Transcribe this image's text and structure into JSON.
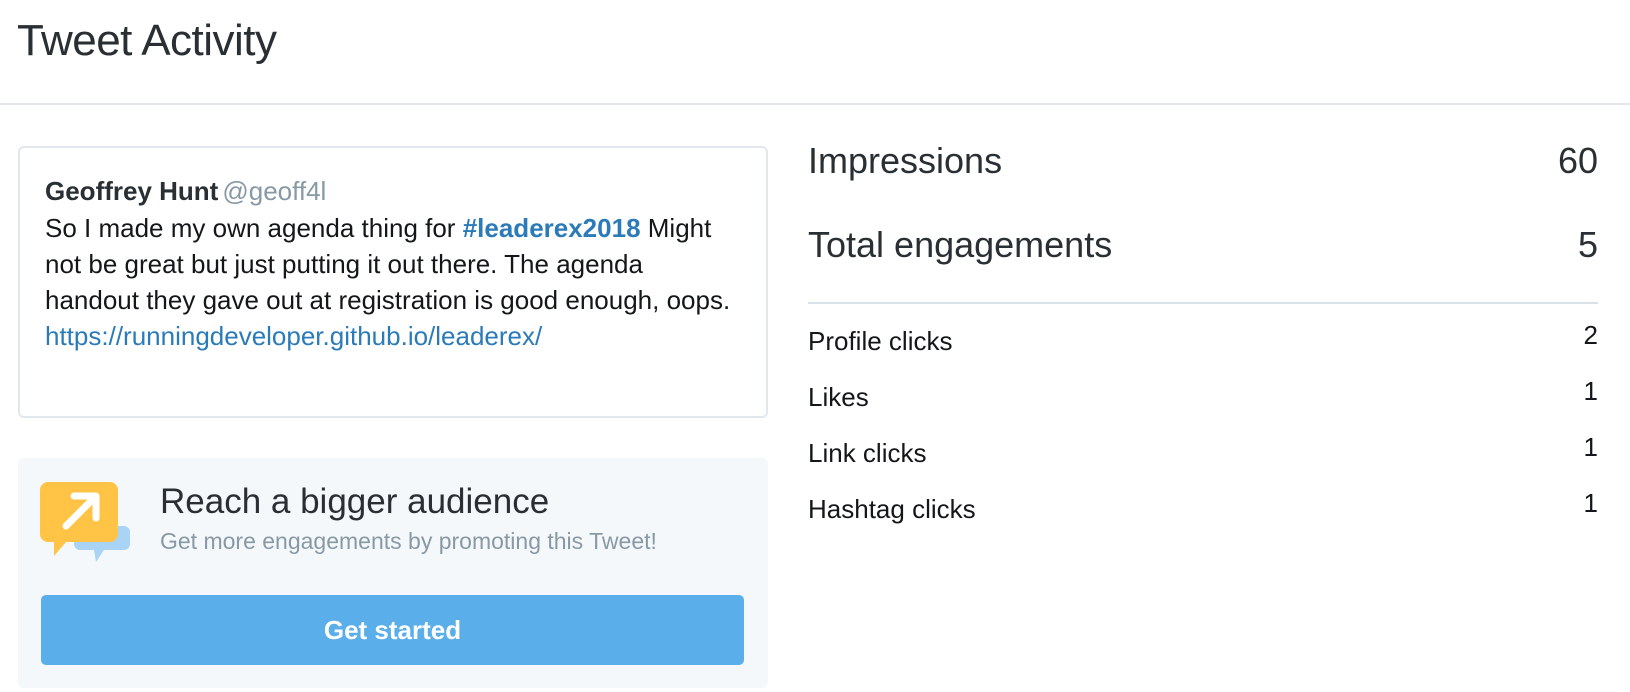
{
  "header": {
    "title": "Tweet Activity"
  },
  "tweet": {
    "name": "Geoffrey Hunt",
    "handle": "@geoff4l",
    "text_before": "So I made my own agenda thing for ",
    "hashtag": "#leaderex2018",
    "text_after": " Might not be great but just putting it out there. The agenda handout they gave out at registration is good enough, oops.",
    "link": "https://runningdeveloper.github.io/leaderex/"
  },
  "promo": {
    "icon": "promote-arrow-icon",
    "title": "Reach a bigger audience",
    "subtitle": "Get more engagements by promoting this Tweet!",
    "button_label": "Get started"
  },
  "metrics": {
    "impressions": {
      "label": "Impressions",
      "value": "60"
    },
    "total_engagements": {
      "label": "Total engagements",
      "value": "5"
    },
    "breakdown": [
      {
        "label": "Profile clicks",
        "value": "2"
      },
      {
        "label": "Likes",
        "value": "1"
      },
      {
        "label": "Link clicks",
        "value": "1"
      },
      {
        "label": "Hashtag clicks",
        "value": "1"
      }
    ]
  },
  "colors": {
    "link": "#2b7bb9",
    "button": "#5aaeea",
    "promo_bg": "#f5f8fa",
    "icon_yellow": "#ffc445",
    "icon_blue": "#a9d4f5"
  }
}
